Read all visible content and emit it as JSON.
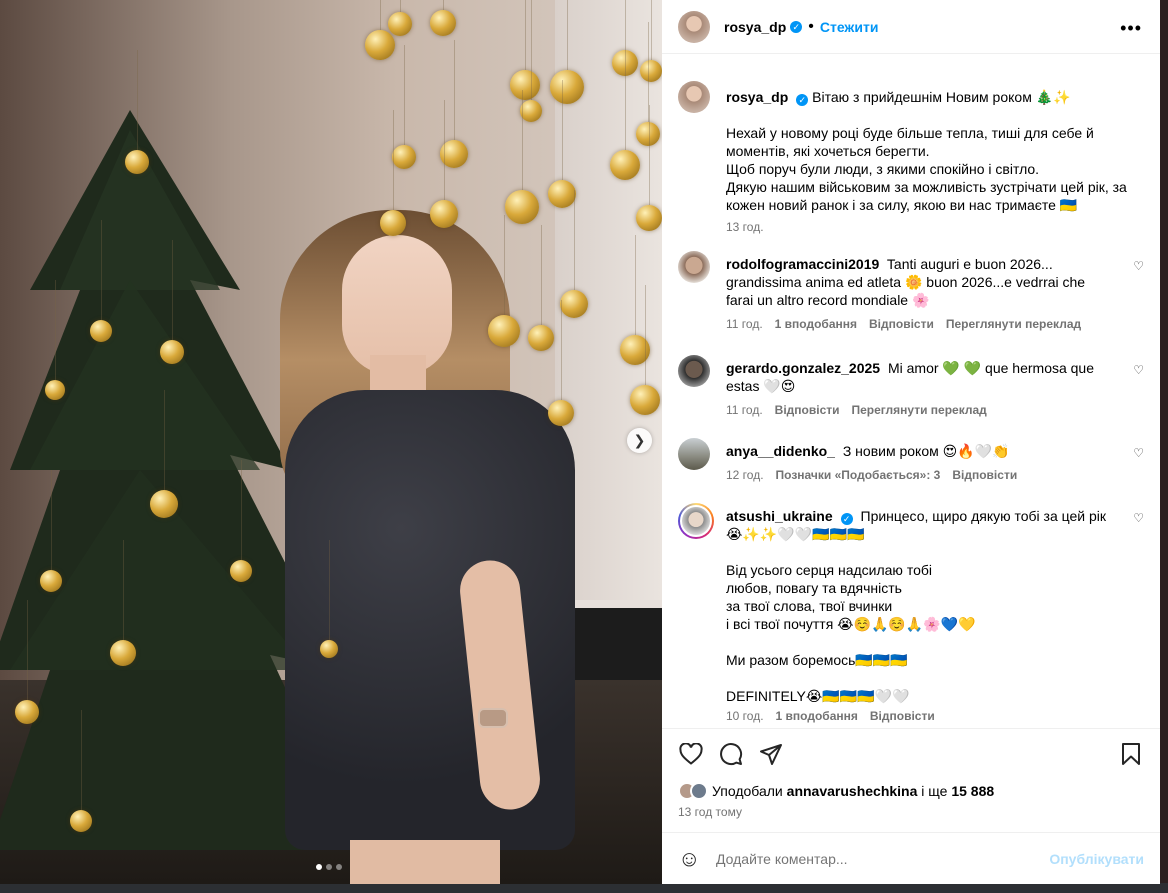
{
  "post": {
    "username": "rosya_dp",
    "follow_label": "Стежити",
    "dot": "•",
    "more_icon": "more-horizontal-icon"
  },
  "caption": {
    "username": "rosya_dp",
    "title": "Вітаю з прийдешнім Новим роком 🎄✨",
    "lines": [
      "Нехай у новому році буде більше тепла, тиші для себе й моментів, які хочеться берегти.",
      "Щоб поруч були люди, з якими спокійно і світло.",
      "Дякую нашим військовим за можливість зустрічати цей рік, за кожен новий ранок і за силу, якою ви нас тримаєте 🇺🇦"
    ],
    "time": "13 год."
  },
  "comments": [
    {
      "username": "rodolfogramaccini2019",
      "text": "Tanti auguri e buon 2026... grandissima anima ed atleta 🌼 buon 2026...e vedrrai che farai un altro record mondiale 🌸",
      "time": "11 год.",
      "likes": "1 вподобання",
      "reply": "Відповісти",
      "translate": "Переглянути переклад"
    },
    {
      "username": "gerardo.gonzalez_2025",
      "text": "Mi amor 💚 💚 que hermosa que estas 🤍😍",
      "time": "11 год.",
      "reply": "Відповісти",
      "translate": "Переглянути переклад"
    },
    {
      "username": "anya__didenko_",
      "text": "З новим роком 😍🔥🤍👏",
      "time": "12 год.",
      "likes": "Позначки «Подобається»: 3",
      "reply": "Відповісти"
    },
    {
      "username": "atsushi_ukraine",
      "text": "Принцесо, щиро дякую тобі за цей рік 😭✨✨🤍🤍🇺🇦🇺🇦🇺🇦",
      "body": [
        "Від усього серця надсилаю тобі",
        "любов, повагу та вдячність",
        "за твої слова, твої вчинки",
        "і всі твої почуття 😭☺️🙏☺️🙏🌸💙💛",
        "",
        "Ми разом боремось🇺🇦🇺🇦🇺🇦",
        "",
        "DEFINITELY😭🇺🇦🇺🇦🇺🇦🤍🤍"
      ],
      "time": "10 год.",
      "likes": "1 вподобання",
      "reply": "Відповісти"
    }
  ],
  "actions": {
    "like_icon": "heart-icon",
    "comment_icon": "comment-icon",
    "share_icon": "share-icon",
    "save_icon": "bookmark-icon"
  },
  "likes": {
    "prefix": "Уподобали",
    "user": "annavarushechkina",
    "middle": "і ще",
    "count": "15 888"
  },
  "post_time": "13 год тому",
  "add_comment": {
    "placeholder": "Додайте коментар...",
    "submit": "Опублікувати"
  },
  "carousel": {
    "total": 3,
    "active": 1
  }
}
